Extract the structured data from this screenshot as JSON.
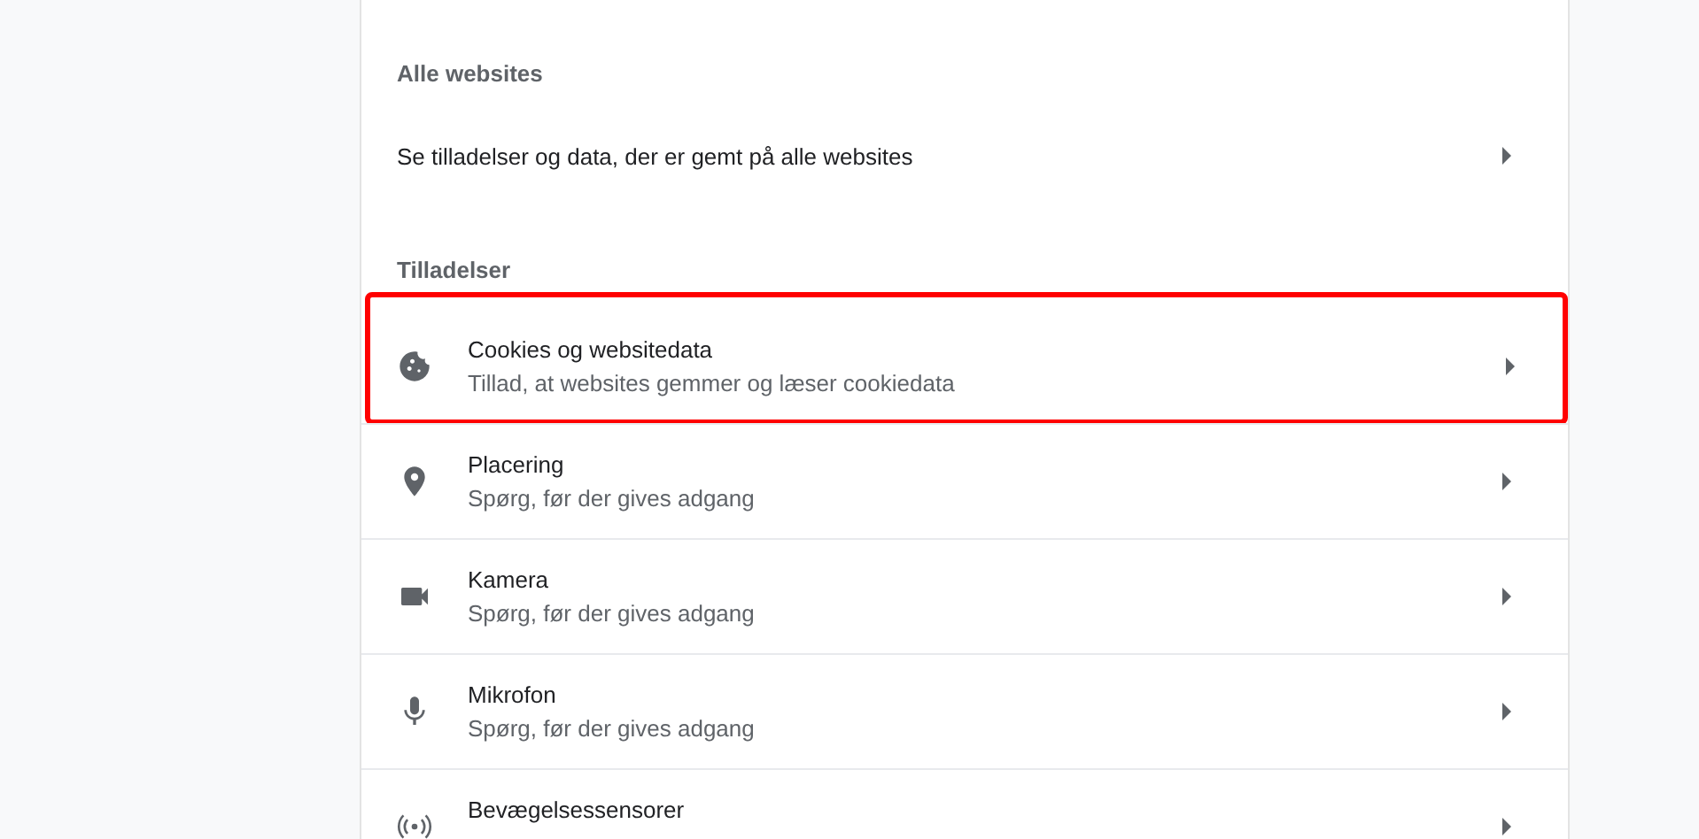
{
  "sections": [
    {
      "title": "Alle websites",
      "items": [
        {
          "kind": "plain",
          "title": "Se tilladelser og data, der er gemt på alle websites",
          "highlighted": false
        }
      ]
    },
    {
      "title": "Tilladelser",
      "items": [
        {
          "kind": "cookie",
          "title": "Cookies og websitedata",
          "subtitle": "Tillad, at websites gemmer og læser cookiedata",
          "highlighted": true
        },
        {
          "kind": "location",
          "title": "Placering",
          "subtitle": "Spørg, før der gives adgang",
          "highlighted": false
        },
        {
          "kind": "camera",
          "title": "Kamera",
          "subtitle": "Spørg, før der gives adgang",
          "highlighted": false
        },
        {
          "kind": "microphone",
          "title": "Mikrofon",
          "subtitle": "Spørg, før der gives adgang",
          "highlighted": false
        },
        {
          "kind": "sensors",
          "title": "Bevægelsessensorer",
          "highlighted": false
        }
      ]
    }
  ]
}
